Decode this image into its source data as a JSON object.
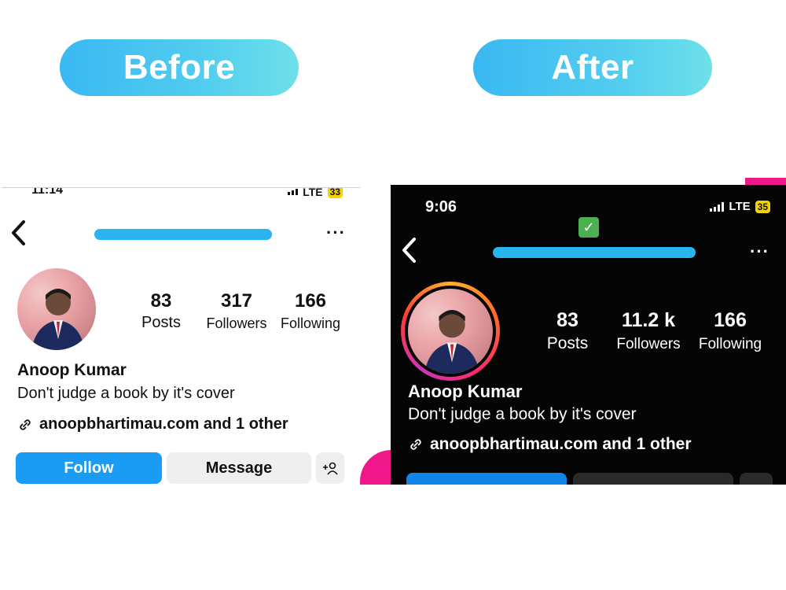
{
  "labels": {
    "before": "Before",
    "after": "After"
  },
  "before": {
    "time": "11:14",
    "network": "LTE",
    "battery": "33",
    "stats": {
      "posts": "83",
      "posts_label": "Posts",
      "followers": "317",
      "followers_label": "Followers",
      "following": "166",
      "following_label": "Following"
    },
    "name": "Anoop Kumar",
    "bio": "Don't judge a book by it's cover",
    "link": "anoopbhartimau.com and 1 other",
    "follow_label": "Follow",
    "message_label": "Message"
  },
  "after": {
    "time": "9:06",
    "network": "LTE",
    "battery": "35",
    "stats": {
      "posts": "83",
      "posts_label": "Posts",
      "followers": "11.2 k",
      "followers_label": "Followers",
      "following": "166",
      "following_label": "Following"
    },
    "name": "Anoop Kumar",
    "bio": "Don't judge a book by it's cover",
    "link": "anoopbhartimau.com and 1 other"
  },
  "icons": {
    "back": "chevron-left-icon",
    "more": "more-dots-icon",
    "link": "link-icon",
    "add_user": "add-user-icon",
    "verified": "check-emoji-icon"
  },
  "colors": {
    "pill": "#3ab8f2",
    "follow": "#1a9cf4",
    "dark_bg": "#050505",
    "accent_pink": "#f0178a"
  }
}
